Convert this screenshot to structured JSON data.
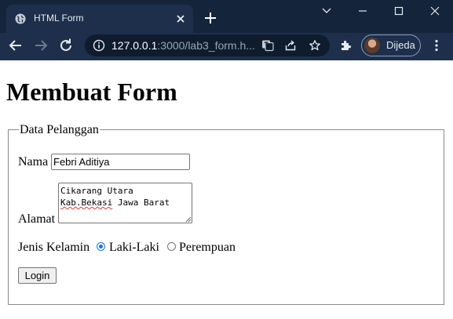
{
  "browser": {
    "tab_title": "HTML Form",
    "url_host": "127.0.0.1",
    "url_path": ":3000/lab3_form.h...",
    "profile_name": "Dijeda"
  },
  "page": {
    "heading": "Membuat Form",
    "form": {
      "legend": "Data Pelanggan",
      "nama_label": "Nama",
      "nama_value": "Febri Aditiya",
      "alamat_label": "Alamat",
      "alamat_line1": "Cikarang Utara",
      "alamat_line2_misspelled": "Kab.Bekasi",
      "alamat_line2_rest": " Jawa Barat",
      "gender_label": "Jenis Kelamin",
      "gender_options": [
        "Laki-Laki",
        "Perempuan"
      ],
      "gender_selected": "Laki-Laki",
      "submit_label": "Login"
    }
  }
}
